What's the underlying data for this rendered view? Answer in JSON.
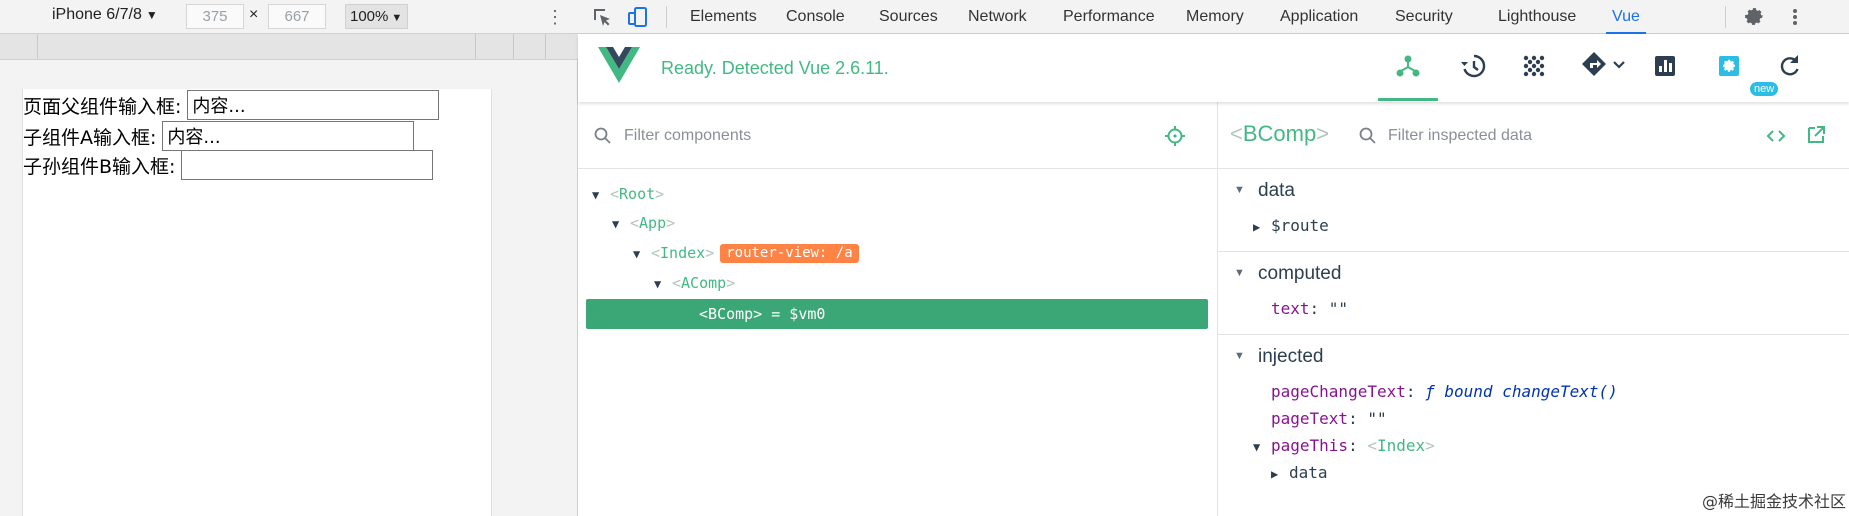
{
  "device_toolbar": {
    "device": "iPhone 6/7/8",
    "width": "375",
    "separator": "×",
    "height": "667",
    "zoom": "100%"
  },
  "page": {
    "rows": [
      {
        "label": "页面父组件输入框:",
        "value": "内容..."
      },
      {
        "label": "子组件A输入框:",
        "value": "内容..."
      },
      {
        "label": "子孙组件B输入框:",
        "value": ""
      }
    ]
  },
  "devtools": {
    "tabs": [
      "Elements",
      "Console",
      "Sources",
      "Network",
      "Performance",
      "Memory",
      "Application",
      "Security",
      "Lighthouse",
      "Vue"
    ],
    "active_tab": "Vue"
  },
  "vue": {
    "status": "Ready. Detected Vue 2.6.11.",
    "new_badge": "new",
    "accent": "#42b983"
  },
  "components": {
    "filter_placeholder": "Filter components",
    "tree": {
      "root": "Root",
      "app": "App",
      "index": "Index",
      "router_badge": "router-view: /a",
      "acomp": "AComp",
      "bcomp": "<BComp> = $vm0"
    }
  },
  "inspector": {
    "component": "BComp",
    "filter_placeholder": "Filter inspected data",
    "sections": {
      "data": {
        "title": "data",
        "route_key": "$route"
      },
      "computed": {
        "title": "computed",
        "text_key": "text",
        "text_value": "\"\""
      },
      "injected": {
        "title": "injected",
        "page_change_key": "pageChangeText",
        "page_change_value": "ƒ bound changeText()",
        "page_text_key": "pageText",
        "page_text_value": "\"\"",
        "page_this_key": "pageThis",
        "page_this_value": "Index",
        "data_key": "data"
      }
    }
  },
  "watermark": "@稀土掘金技术社区"
}
